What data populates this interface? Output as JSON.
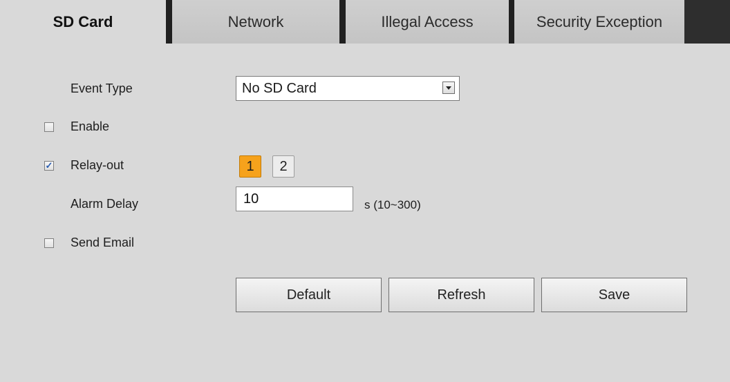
{
  "tabs": [
    {
      "label": "SD Card",
      "active": true
    },
    {
      "label": "Network",
      "active": false
    },
    {
      "label": "Illegal Access",
      "active": false
    },
    {
      "label": "Security Exception",
      "active": false
    }
  ],
  "form": {
    "event_type_label": "Event Type",
    "event_type_value": "No SD Card",
    "enable_label": "Enable",
    "enable_checked": false,
    "relay_out_label": "Relay-out",
    "relay_out_checked": true,
    "relay_channels": [
      "1",
      "2"
    ],
    "relay_selected": "1",
    "alarm_delay_label": "Alarm Delay",
    "alarm_delay_value": "10",
    "alarm_delay_unit": "s (10~300)",
    "send_email_label": "Send Email",
    "send_email_checked": false
  },
  "buttons": {
    "default_label": "Default",
    "refresh_label": "Refresh",
    "save_label": "Save"
  },
  "colors": {
    "background": "#d9d9d9",
    "relay_active": "#f6a21c",
    "checkmark": "#2a5db0"
  }
}
